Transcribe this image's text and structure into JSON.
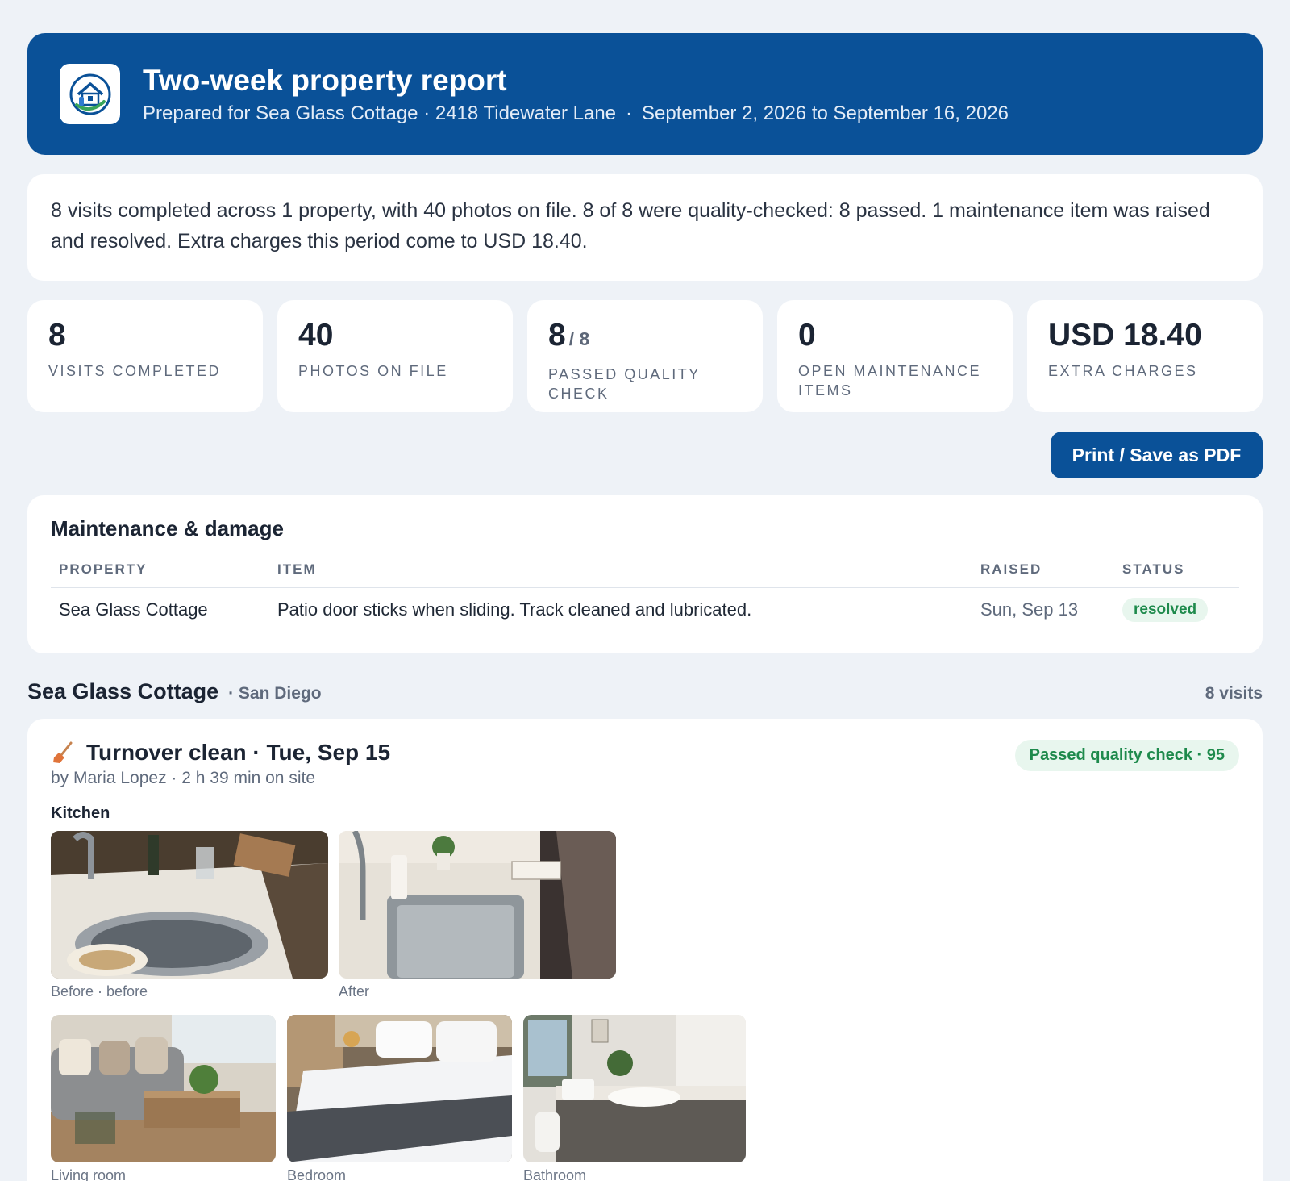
{
  "header": {
    "title": "Two-week property report",
    "prepared_for": "Prepared for Sea Glass Cottage · 2418 Tidewater Lane",
    "separator": "·",
    "period": "September 2, 2026 to September 16, 2026",
    "logo_icon": "house-cleaning-logo-icon"
  },
  "summary": {
    "text": "8 visits completed across 1 property, with 40 photos on file. 8 of 8 were quality-checked: 8 passed. 1 maintenance item was raised and resolved. Extra charges this period come to USD 18.40."
  },
  "stats": [
    {
      "value": "8",
      "label": "Visits completed"
    },
    {
      "value": "40",
      "label": "Photos on file"
    },
    {
      "value": "8",
      "of": "/ 8",
      "label": "Passed quality check"
    },
    {
      "value": "0",
      "label": "Open maintenance items"
    },
    {
      "value": "USD 18.40",
      "label": "Extra charges"
    }
  ],
  "actions": {
    "print_label": "Print / Save as PDF"
  },
  "maintenance": {
    "title": "Maintenance & damage",
    "columns": [
      "PROPERTY",
      "ITEM",
      "RAISED",
      "STATUS"
    ],
    "rows": [
      {
        "property": "Sea Glass Cottage",
        "item": "Patio door sticks when sliding. Track cleaned and lubricated.",
        "raised": "Sun, Sep 13",
        "status": "resolved"
      }
    ]
  },
  "property": {
    "name": "Sea Glass Cottage",
    "city": "· San Diego",
    "visits": "8 visits"
  },
  "visit": {
    "icon": "broom-icon",
    "title": "Turnover clean · Tue, Sep 15",
    "by": "by Maria Lopez · 2 h 39 min on site",
    "qc": "Passed quality check · 95",
    "room": "Kitchen",
    "captions": {
      "before": "Before · before",
      "after": "After",
      "living": "Living room",
      "bedroom": "Bedroom",
      "bathroom": "Bathroom"
    }
  },
  "colors": {
    "brand": "#0a5198",
    "success_bg": "#e8f6ee",
    "success_text": "#1e8a4c",
    "page_bg": "#eef2f7"
  }
}
